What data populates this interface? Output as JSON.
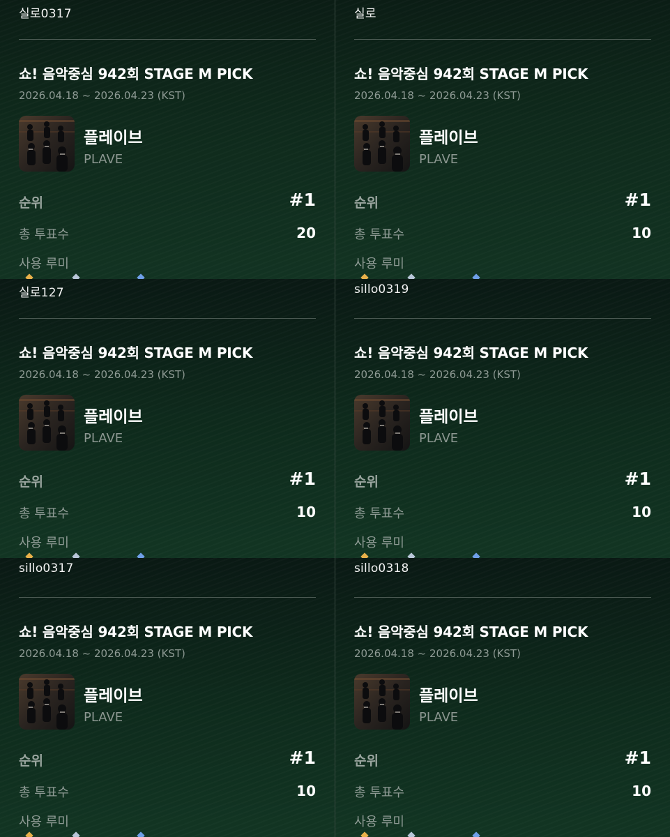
{
  "panels": [
    {
      "user_id": "실로0317",
      "title": "쇼! 음악중심 942회 STAGE M PICK",
      "period": "2026.04.18 ~ 2026.04.23 (KST)",
      "artist_ko": "플레이브",
      "artist_en": "PLAVE",
      "rank_label": "순위",
      "rank": "#1",
      "votes_label": "총 투표수",
      "votes": "20",
      "lumi_label": "사용 루미"
    },
    {
      "user_id": "실로",
      "title": "쇼! 음악중심 942회 STAGE M PICK",
      "period": "2026.04.18 ~ 2026.04.23 (KST)",
      "artist_ko": "플레이브",
      "artist_en": "PLAVE",
      "rank_label": "순위",
      "rank": "#1",
      "votes_label": "총 투표수",
      "votes": "10",
      "lumi_label": "사용 루미"
    },
    {
      "user_id": "실로127",
      "title": "쇼! 음악중심 942회 STAGE M PICK",
      "period": "2026.04.18 ~ 2026.04.23 (KST)",
      "artist_ko": "플레이브",
      "artist_en": "PLAVE",
      "rank_label": "순위",
      "rank": "#1",
      "votes_label": "총 투표수",
      "votes": "10",
      "lumi_label": "사용 루미"
    },
    {
      "user_id": "sillo0319",
      "title": "쇼! 음악중심 942회 STAGE M PICK",
      "period": "2026.04.18 ~ 2026.04.23 (KST)",
      "artist_ko": "플레이브",
      "artist_en": "PLAVE",
      "rank_label": "순위",
      "rank": "#1",
      "votes_label": "총 투표수",
      "votes": "10",
      "lumi_label": "사용 루미"
    },
    {
      "user_id": "sillo0317",
      "title": "쇼! 음악중심 942회 STAGE M PICK",
      "period": "2026.04.18 ~ 2026.04.23 (KST)",
      "artist_ko": "플레이브",
      "artist_en": "PLAVE",
      "rank_label": "순위",
      "rank": "#1",
      "votes_label": "총 투표수",
      "votes": "10",
      "lumi_label": "사용 루미"
    },
    {
      "user_id": "sillo0318",
      "title": "쇼! 음악중심 942회 STAGE M PICK",
      "period": "2026.04.18 ~ 2026.04.23 (KST)",
      "artist_ko": "플레이브",
      "artist_en": "PLAVE",
      "rank_label": "순위",
      "rank": "#1",
      "votes_label": "총 투표수",
      "votes": "10",
      "lumi_label": "사용 루미"
    }
  ],
  "colors": {
    "background": "#0f2a1c",
    "text_primary": "#ffffff",
    "text_secondary": "#8e9a94",
    "divider": "#4c5a53",
    "gem_gold": "#e8b04a",
    "gem_silver": "#b8c6d8",
    "gem_blue": "#6f9fe8"
  }
}
